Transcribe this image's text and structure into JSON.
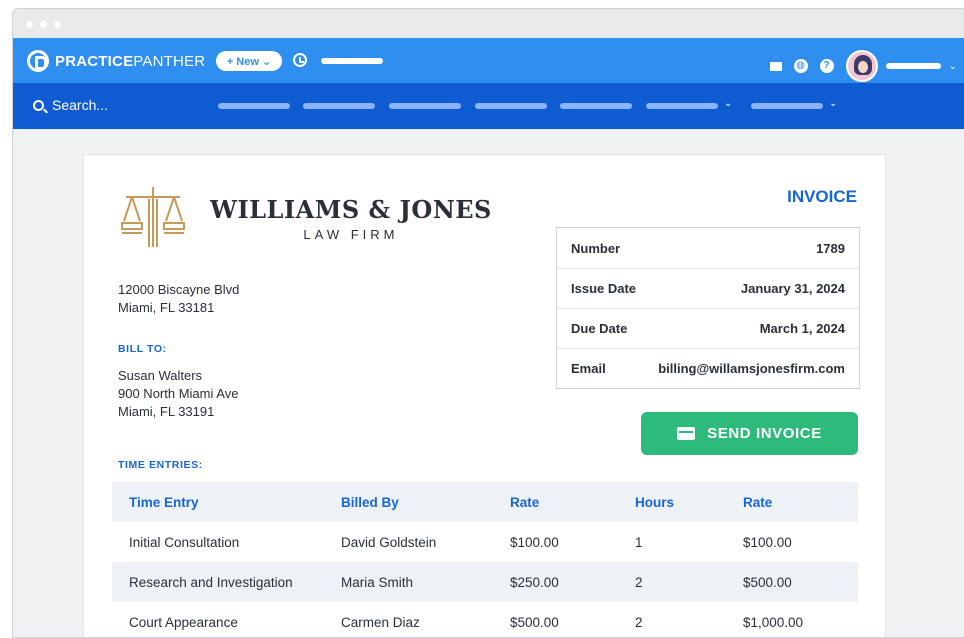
{
  "app": {
    "logo_bold": "PRACTICE",
    "logo_light": "PANTHER",
    "new_button": "+ New ⌄"
  },
  "icons": {
    "mail": "mail-icon",
    "globe": "globe-icon",
    "help": "help-icon",
    "clock": "clock-icon",
    "search": "search-icon"
  },
  "search": {
    "placeholder": "Search..."
  },
  "firm": {
    "name": "WILLIAMS & JONES",
    "subtitle": "LAW FIRM",
    "address_line1": "12000 Biscayne Blvd",
    "address_line2": "Miami, FL 33181"
  },
  "bill_to": {
    "label": "BILL TO:",
    "name": "Susan Walters",
    "line1": "900 North Miami Ave",
    "line2": "Miami, FL 33191"
  },
  "invoice": {
    "title": "INVOICE",
    "rows": [
      {
        "key": "Number",
        "value": "1789"
      },
      {
        "key": "Issue Date",
        "value": "January 31, 2024"
      },
      {
        "key": "Due Date",
        "value": "March 1, 2024"
      },
      {
        "key": "Email",
        "value": "billing@willamsjonesfirm.com"
      }
    ],
    "send_label": "SEND INVOICE"
  },
  "time_entries": {
    "label": "TIME ENTRIES:",
    "headers": [
      "Time Entry",
      "Billed By",
      "Rate",
      "Hours",
      "Rate"
    ],
    "rows": [
      [
        "Initial Consultation",
        "David Goldstein",
        "$100.00",
        "1",
        "$100.00"
      ],
      [
        "Research and Investigation",
        "Maria Smith",
        "$250.00",
        "2",
        "$500.00"
      ],
      [
        "Court Appearance",
        "Carmen Diaz",
        "$500.00",
        "2",
        "$1,000.00"
      ]
    ]
  },
  "colors": {
    "topbar": "#2f8ff0",
    "navbar": "#0f5bd1",
    "accent": "#1766d6",
    "send": "#2dba7a",
    "gold": "#c79a5a"
  }
}
